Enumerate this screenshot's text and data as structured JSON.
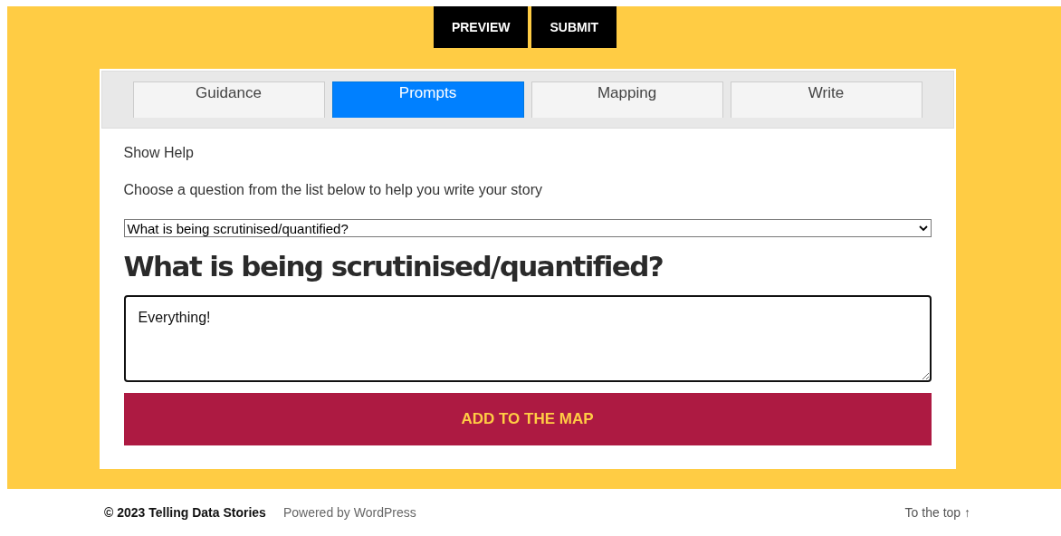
{
  "header_buttons": [
    "PREVIEW",
    "SUBMIT"
  ],
  "tabs": [
    {
      "label": "Guidance",
      "selected": false
    },
    {
      "label": "Prompts",
      "selected": true
    },
    {
      "label": "Mapping",
      "selected": false
    },
    {
      "label": "Write",
      "selected": false
    }
  ],
  "show_help": "Show Help",
  "instruction": "Choose a question from the list below to help you write your story",
  "question_select": {
    "value": "What is being scrutinised/quantified?"
  },
  "question_heading": "What is being scrutinised/quantified?",
  "answer": {
    "value": "Everything!"
  },
  "add_button": "ADD TO THE MAP",
  "footer": {
    "copyright": "© 2023 Telling Data Stories",
    "powered_by": "Powered by WordPress",
    "to_top": "To the top ↑"
  }
}
